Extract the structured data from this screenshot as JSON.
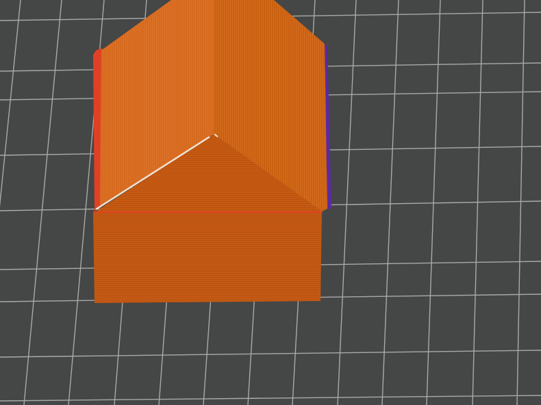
{
  "viewport": {
    "background_color": "#454646",
    "grid_color": "#a9aaaa"
  },
  "model": {
    "material_color": "#cc5d16",
    "roof_left_color": "#d66a1e",
    "roof_right_color": "#c9600f",
    "gable_color": "#c65a12",
    "wall_color": "#c55a14",
    "edge_highlight_color": "#e04125",
    "ridge_highlight_color": "#efe3d6",
    "side_accent_color": "#5b2aa0"
  }
}
